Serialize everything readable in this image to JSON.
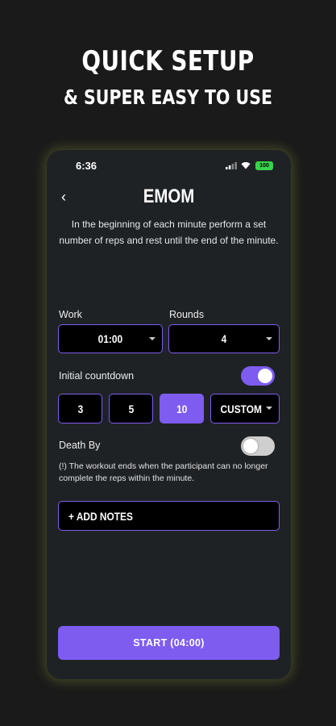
{
  "promo": {
    "title": "QUICK SETUP",
    "subtitle": "& SUPER EASY TO USE"
  },
  "status_bar": {
    "time": "6:36",
    "battery": "100",
    "icons": [
      "signal-icon",
      "wifi-icon",
      "battery-icon"
    ]
  },
  "header": {
    "back_icon": "chevron-left-icon",
    "back_glyph": "‹",
    "title": "EMOM",
    "description": "In the beginning of each minute perform a set number of reps and rest until the end of the minute."
  },
  "work": {
    "label": "Work",
    "value": "01:00"
  },
  "rounds": {
    "label": "Rounds",
    "value": "4"
  },
  "initial_countdown": {
    "label": "Initial countdown",
    "enabled": true,
    "options": [
      "3",
      "5",
      "10"
    ],
    "selected": "10",
    "custom_label": "CUSTOM"
  },
  "death_by": {
    "label": "Death By",
    "enabled": false,
    "note": "(!) The workout ends when the participant can no longer complete the reps within the minute."
  },
  "notes_button": "+ ADD NOTES",
  "start_button": "START (04:00)",
  "colors": {
    "accent": "#7e5cf0",
    "background": "#1a1a1a",
    "card": "#1f2225",
    "battery": "#37d34b"
  }
}
